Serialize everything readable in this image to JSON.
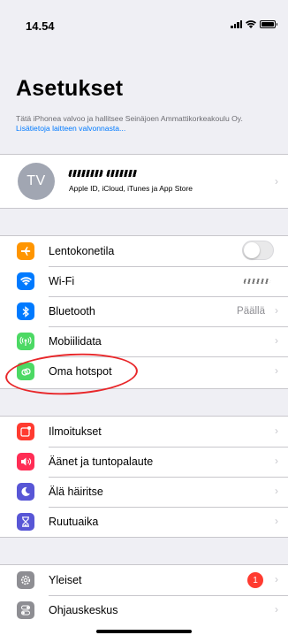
{
  "status_bar": {
    "time": "14.54"
  },
  "header": {
    "title": "Asetukset",
    "supervise_text": "Tätä iPhonea valvoo ja hallitsee Seinäjoen Ammattikorkeakoulu Oy. ",
    "supervise_link": "Lisätietoja laitteen valvonnasta..."
  },
  "profile": {
    "initials": "TV",
    "subtitle": "Apple ID, iCloud, iTunes ja App Store"
  },
  "connectivity": [
    {
      "label": "Lentokonetila",
      "icon": "airplane-icon",
      "color": "#ff9500",
      "toggle": false
    },
    {
      "label": "Wi-Fi",
      "icon": "wifi-icon",
      "color": "#007aff",
      "value": ""
    },
    {
      "label": "Bluetooth",
      "icon": "bluetooth-icon",
      "color": "#007aff",
      "value": "Päällä"
    },
    {
      "label": "Mobiilidata",
      "icon": "antenna-icon",
      "color": "#4cd964"
    },
    {
      "label": "Oma hotspot",
      "icon": "hotspot-icon",
      "color": "#4cd964"
    }
  ],
  "notifications": [
    {
      "label": "Ilmoitukset",
      "icon": "notifications-icon",
      "color": "#ff3b30"
    },
    {
      "label": "Äänet ja tuntopalaute",
      "icon": "sound-icon",
      "color": "#ff2d55"
    },
    {
      "label": "Älä häiritse",
      "icon": "moon-icon",
      "color": "#5856d6"
    },
    {
      "label": "Ruutuaika",
      "icon": "hourglass-icon",
      "color": "#5856d6"
    }
  ],
  "general": [
    {
      "label": "Yleiset",
      "icon": "gear-icon",
      "color": "#8e8e93",
      "badge": "1"
    },
    {
      "label": "Ohjauskeskus",
      "icon": "switches-icon",
      "color": "#8e8e93"
    }
  ]
}
